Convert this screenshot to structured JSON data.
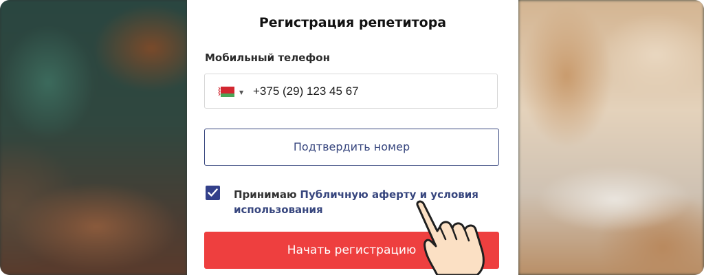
{
  "form": {
    "title": "Регистрация репетитора",
    "phone_label": "Мобильный телефон",
    "phone_value": "+375 (29) 123 45 67",
    "country_flag_icon": "belarus-flag-icon",
    "confirm_label": "Подтвердить номер",
    "agree_prefix": "Принимаю",
    "agree_link": "Публичную аферту и условия использования",
    "agree_checked": true,
    "start_label": "Начать регистрацию"
  },
  "colors": {
    "primary": "#37467e",
    "accent_red": "#ee3f3f",
    "checkbox": "#33408a"
  }
}
